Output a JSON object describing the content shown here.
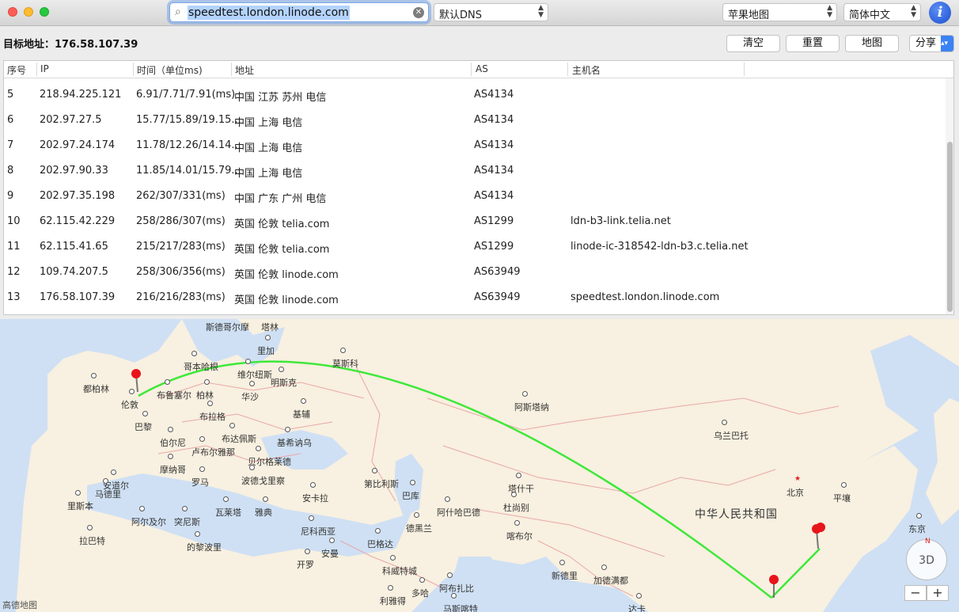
{
  "toolbar": {
    "search_value": "speedtest.london.linode.com",
    "dns_select": "默认DNS",
    "map_select": "苹果地图",
    "language_select": "简体中文",
    "info_label": "i"
  },
  "target": {
    "label": "目标地址：176.58.107.39"
  },
  "actions": {
    "clear": "清空",
    "reset": "重置",
    "map": "地图",
    "share": "分享"
  },
  "table": {
    "headers": [
      "序号",
      "IP",
      "时间（单位ms)",
      "地址",
      "AS",
      "主机名"
    ],
    "rows": [
      {
        "no": "5",
        "ip": "218.94.225.121",
        "time": "6.91/7.71/7.91(ms)",
        "addr": "中国 江苏 苏州 电信",
        "as": "AS4134",
        "host": ""
      },
      {
        "no": "6",
        "ip": "202.97.27.5",
        "time": "15.77/15.89/19.15...",
        "addr": "中国 上海 电信",
        "as": "AS4134",
        "host": ""
      },
      {
        "no": "7",
        "ip": "202.97.24.174",
        "time": "11.78/12.26/14.14...",
        "addr": "中国 上海 电信",
        "as": "AS4134",
        "host": ""
      },
      {
        "no": "8",
        "ip": "202.97.90.33",
        "time": "11.85/14.01/15.79...",
        "addr": "中国 上海 电信",
        "as": "AS4134",
        "host": ""
      },
      {
        "no": "9",
        "ip": "202.97.35.198",
        "time": "262/307/331(ms)",
        "addr": "中国 广东 广州 电信",
        "as": "AS4134",
        "host": ""
      },
      {
        "no": "10",
        "ip": "62.115.42.229",
        "time": "258/286/307(ms)",
        "addr": "英国 伦敦 telia.com",
        "as": "AS1299",
        "host": "ldn-b3-link.telia.net"
      },
      {
        "no": "11",
        "ip": "62.115.41.65",
        "time": "215/217/283(ms)",
        "addr": "英国 伦敦 telia.com",
        "as": "AS1299",
        "host": "linode-ic-318542-ldn-b3.c.telia.net"
      },
      {
        "no": "12",
        "ip": "109.74.207.5",
        "time": "258/306/356(ms)",
        "addr": "英国 伦敦 linode.com",
        "as": "AS63949",
        "host": ""
      },
      {
        "no": "13",
        "ip": "176.58.107.39",
        "time": "216/216/283(ms)",
        "addr": "英国 伦敦 linode.com",
        "as": "AS63949",
        "host": "speedtest.london.linode.com"
      }
    ]
  },
  "map": {
    "cities": [
      "斯德哥尔摩",
      "塔林",
      "里加",
      "哥本哈根",
      "维尔纽斯",
      "莫斯科",
      "明斯克",
      "都柏林",
      "伦敦",
      "布鲁塞尔",
      "柏林",
      "华沙",
      "基辅",
      "布拉格",
      "巴黎",
      "伯尔尼",
      "布达佩斯",
      "基希讷乌",
      "卢布尔雅那",
      "摩纳哥",
      "贝尔格莱德",
      "安道尔",
      "罗马",
      "波德戈里察",
      "马德里",
      "里斯本",
      "瓦莱塔",
      "雅典",
      "安卡拉",
      "第比利斯",
      "巴库",
      "阿什哈巴德",
      "阿斯塔纳",
      "塔什干",
      "杜尚别",
      "喀布尔",
      "阿尔及尔",
      "突尼斯",
      "拉巴特",
      "尼科西亚",
      "的黎波里",
      "开罗",
      "安曼",
      "巴格达",
      "德黑兰",
      "科威特城",
      "多哈",
      "利雅得",
      "阿布扎比",
      "马斯喀特",
      "新德里",
      "加德满都",
      "乌兰巴托",
      "北京",
      "平壤",
      "东京",
      "达卡"
    ],
    "country_label": "中华人民共和国",
    "attribution": "高德地图",
    "compass_label": "3D",
    "compass_north": "N",
    "zoom_out": "−",
    "zoom_in": "+"
  },
  "colors": {
    "route": "#3ee83a",
    "pin": "#e8141c",
    "accent": "#3b82f6"
  }
}
